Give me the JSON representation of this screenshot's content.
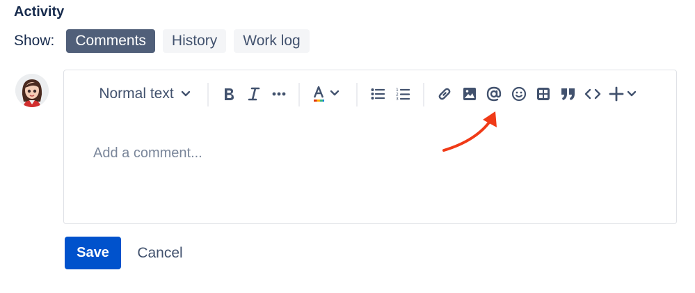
{
  "activity": {
    "title": "Activity",
    "show_label": "Show:",
    "filters": [
      {
        "label": "Comments",
        "active": true
      },
      {
        "label": "History",
        "active": false
      },
      {
        "label": "Work log",
        "active": false
      }
    ]
  },
  "editor": {
    "text_style": "Normal text",
    "placeholder": "Add a comment...",
    "toolbar_icons": [
      "chevron-down-icon",
      "bold-icon",
      "italic-icon",
      "more-icon",
      "text-color-icon",
      "bullet-list-icon",
      "numbered-list-icon",
      "link-icon",
      "image-icon",
      "mention-icon",
      "emoji-icon",
      "table-icon",
      "quote-icon",
      "code-icon",
      "insert-plus-icon"
    ]
  },
  "actions": {
    "save_label": "Save",
    "cancel_label": "Cancel"
  },
  "colors": {
    "primary": "#0052cc",
    "active_filter": "#505f79",
    "annotation_arrow": "#f03a17"
  }
}
